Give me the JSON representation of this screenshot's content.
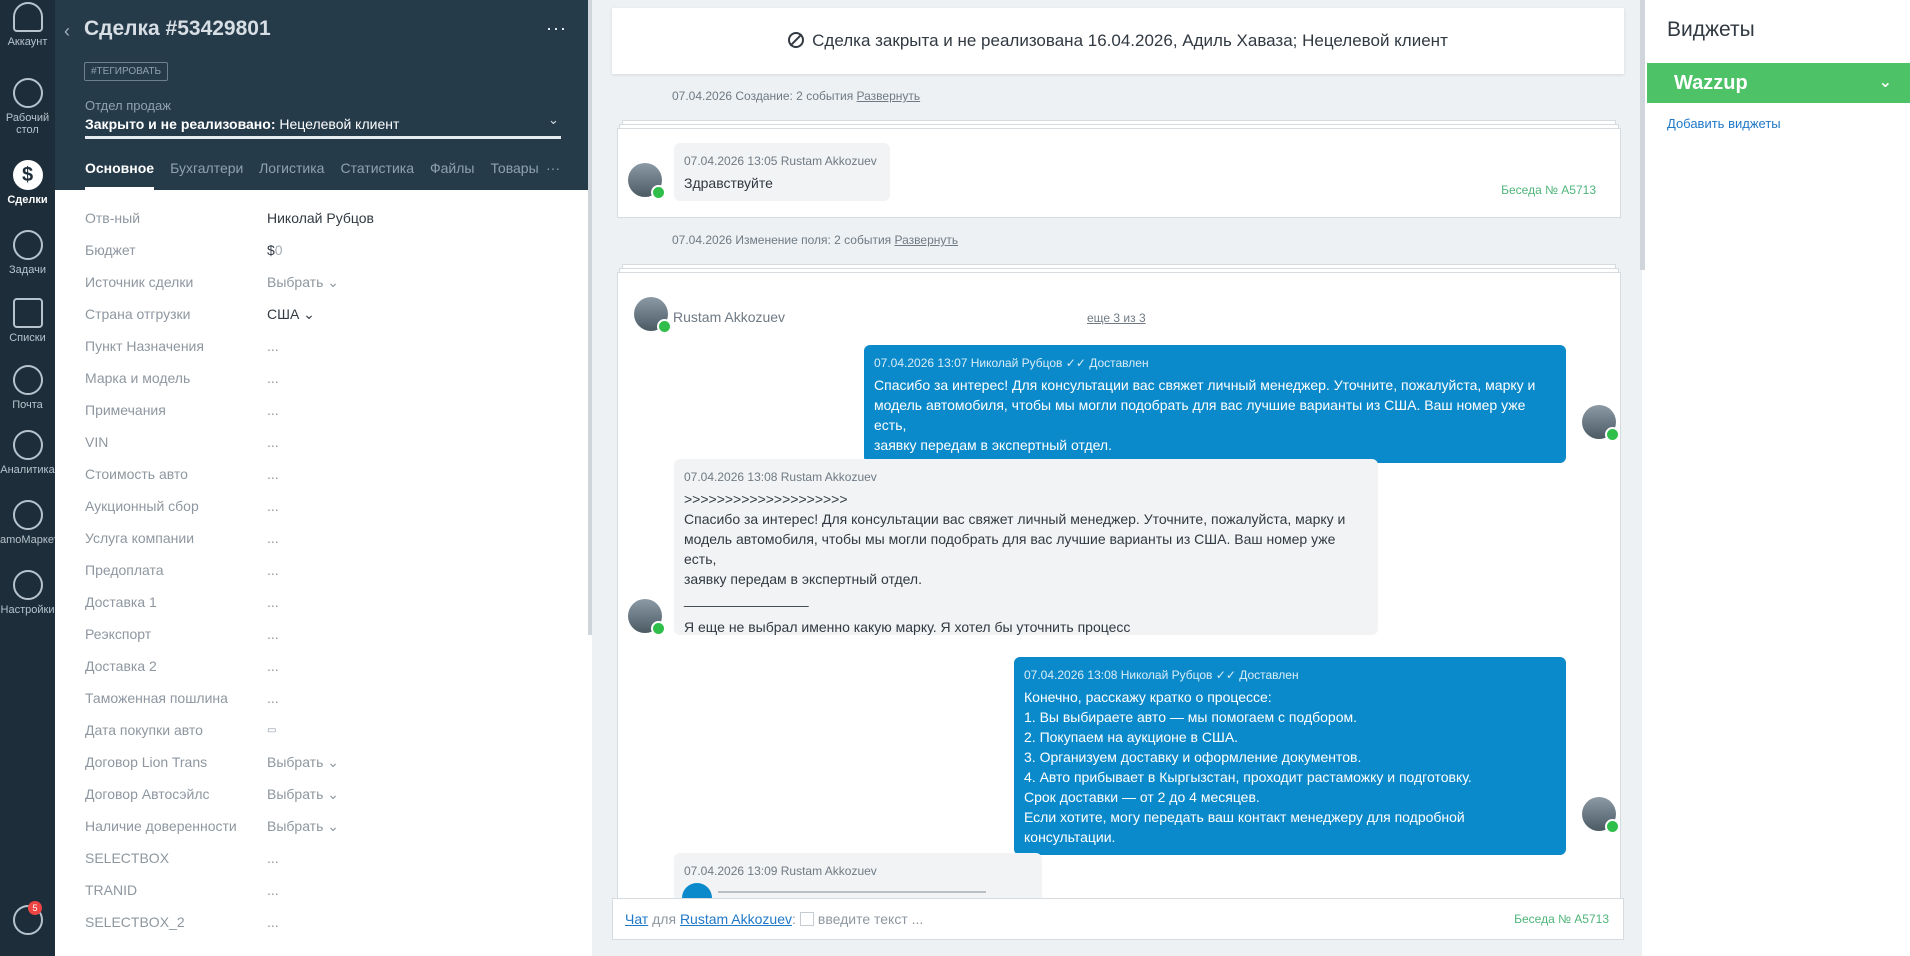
{
  "nav": {
    "items": [
      {
        "label": "Аккаунт",
        "icon": "account-icon"
      },
      {
        "label": "Рабочий",
        "label2": "стол",
        "icon": "dashboard-icon"
      },
      {
        "label": "Сделки",
        "icon": "deals-icon"
      },
      {
        "label": "Задачи",
        "icon": "tasks-icon"
      },
      {
        "label": "Списки",
        "icon": "lists-icon"
      },
      {
        "label": "Почта",
        "icon": "mail-icon"
      },
      {
        "label": "Аналитика",
        "icon": "analytics-icon"
      },
      {
        "label": "amoМаркет",
        "icon": "market-icon"
      },
      {
        "label": "Настройки",
        "icon": "settings-icon"
      }
    ],
    "notif_count": "5"
  },
  "card": {
    "title": "Сделка #53429801",
    "tag_button": "#ТЕГИРОВАТЬ",
    "pipeline": "Отдел продаж",
    "status_label": "Закрыто и не реализовано:",
    "status_value": " Нецелевой клиент",
    "tabs": [
      "Основное",
      "Бухгалтерия",
      "Логистика",
      "Статистика",
      "Файлы",
      "Товары"
    ],
    "tab_more": "···",
    "fields": [
      {
        "label": "Отв-ный",
        "value": "Николай Рубцов"
      },
      {
        "label": "Бюджет",
        "value": "$",
        "value_dim": "0"
      },
      {
        "label": "Источник сделки",
        "value": "Выбрать"
      },
      {
        "label": "Страна отгрузки",
        "value": "США"
      },
      {
        "label": "Пункт Назначения",
        "value": "..."
      },
      {
        "label": "Марка и модель",
        "value": "..."
      },
      {
        "label": "Примечания",
        "value": "..."
      },
      {
        "label": "VIN",
        "value": "..."
      },
      {
        "label": "Стоимость авто",
        "value": "..."
      },
      {
        "label": "Аукционный сбор",
        "value": "..."
      },
      {
        "label": "Услуга компании",
        "value": "..."
      },
      {
        "label": "Предоплата",
        "value": "..."
      },
      {
        "label": "Доставка 1",
        "value": "..."
      },
      {
        "label": "Реэкспорт",
        "value": "..."
      },
      {
        "label": "Доставка 2",
        "value": "..."
      },
      {
        "label": "Таможенная пошлина",
        "value": "..."
      },
      {
        "label": "Дата покупки авто",
        "value": ""
      },
      {
        "label": "Договор Lion Trans",
        "value": "Выбрать"
      },
      {
        "label": "Договор Автосэйлс",
        "value": "Выбрать"
      },
      {
        "label": "Наличие доверенности",
        "value": "Выбрать"
      },
      {
        "label": "SELECTBOX",
        "value": "..."
      },
      {
        "label": "TRANID",
        "value": "..."
      },
      {
        "label": "SELECTBOX_2",
        "value": "..."
      }
    ]
  },
  "feed": {
    "closed_banner": "Сделка закрыта и не реализована 16.04.2026, Адиль Хаваза; Нецелевой клиент",
    "event1": {
      "text": "07.04.2026 Создание: 2 события ",
      "link": "Развернуть"
    },
    "event2": {
      "text": "07.04.2026 Изменение поля: 2 события ",
      "link": "Развернуть"
    },
    "convo1": {
      "meta": "07.04.2026 13:05 Rustam Akkozuev",
      "text": "Здравствуйте",
      "conv_no": "Беседа № A5713"
    },
    "convo2": {
      "contact": "Rustam Akkozuev",
      "more": "еще 3 из 3",
      "msg1": {
        "meta": "07.04.2026 13:07 Николай Рубцов ✓✓ Доставлен",
        "lines": [
          "Спасибо за интерес! Для консультации вас свяжет личный менеджер. Уточните, пожалуйста, марку и",
          "модель автомобиля, чтобы мы могли подобрать для вас лучшие варианты из США. Ваш номер уже есть,",
          "заявку передам в экспертный отдел."
        ]
      },
      "msg2": {
        "meta": "07.04.2026 13:08 Rustam Akkozuev",
        "lines": [
          ">>>>>>>>>>>>>>>>>>>>",
          "Спасибо за интерес! Для консультации вас свяжет личный менеджер. Уточните, пожалуйста, марку и",
          "модель автомобиля, чтобы мы могли подобрать для вас лучшие варианты из США. Ваш номер уже есть,",
          "заявку передам в экспертный отдел.",
          "________________",
          "",
          "Я еще не выбрал именно какую марку. Я хотел бы уточнить процесс"
        ]
      },
      "msg3": {
        "meta": "07.04.2026 13:08 Николай Рубцов ✓✓ Доставлен",
        "lines": [
          "Конечно, расскажу кратко о процессе:",
          "1. Вы выбираете авто — мы помогаем с подбором.",
          "2. Покупаем на аукционе в США.",
          "3. Организуем доставку и оформление документов.",
          "4. Авто прибывает в Кыргызстан, проходит растаможку и подготовку.",
          "Срок доставки — от 2 до 4 месяцев.",
          "Если хотите, могу передать ваш контакт менеджеру для подробной консультации."
        ]
      },
      "msg4": {
        "meta": "07.04.2026 13:09 Rustam Akkozuev"
      }
    },
    "chat_input": {
      "chat_link": "Чат",
      "for": " для ",
      "contact": "Rustam Akkozuev",
      "placeholder": "введите текст ...",
      "conv_no": "Беседа № A5713"
    }
  },
  "widgets": {
    "title": "Виджеты",
    "wazzup": "Wazzup",
    "add": "Добавить виджеты"
  }
}
